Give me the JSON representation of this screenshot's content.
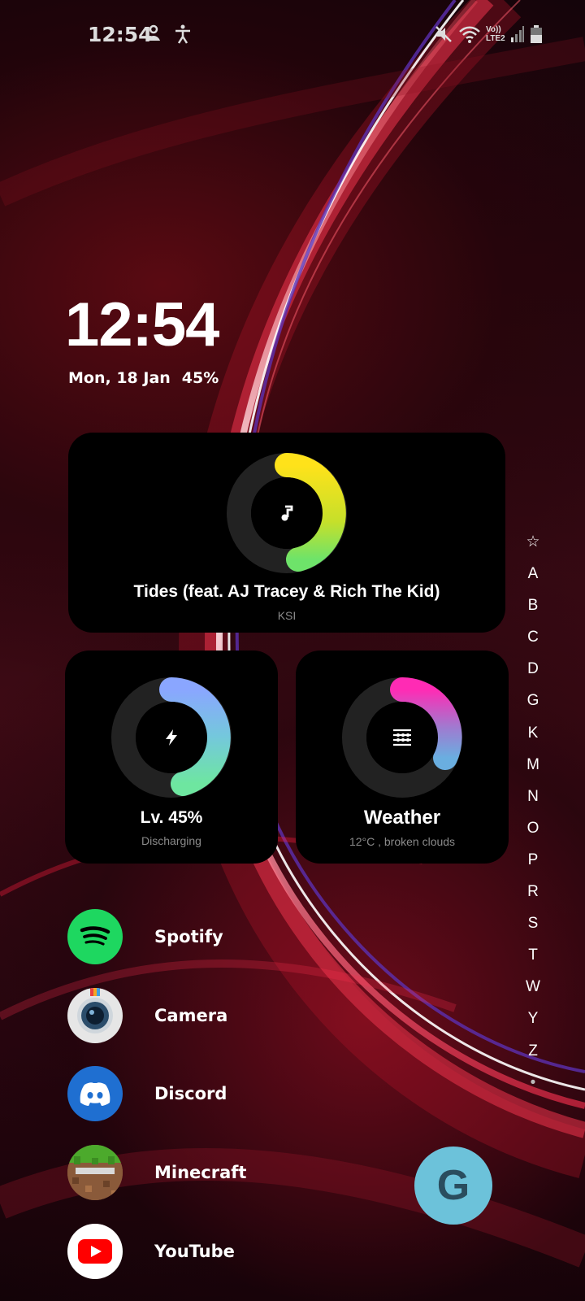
{
  "status_bar": {
    "time": "12:54",
    "lte_label_top": "Vo))",
    "lte_label_bottom": "LTE2",
    "icons": [
      "bixby-icon",
      "accessibility-icon",
      "mute-icon",
      "wifi-icon",
      "signal-icon",
      "battery-icon"
    ]
  },
  "clock": {
    "time": "12:54",
    "date": "Mon, 18 Jan",
    "battery": "45%"
  },
  "music_widget": {
    "title": "Tides (feat. AJ Tracey & Rich The Kid)",
    "artist": "KSI",
    "icon": "music-note-icon"
  },
  "battery_widget": {
    "level": "Lv. 45%",
    "status": "Discharging",
    "icon": "bolt-icon"
  },
  "weather_widget": {
    "title": "Weather",
    "description": "12°C , broken clouds",
    "icon": "weather-lines-icon"
  },
  "alphabet_index": [
    "☆",
    "A",
    "B",
    "C",
    "D",
    "G",
    "K",
    "M",
    "N",
    "O",
    "P",
    "R",
    "S",
    "T",
    "W",
    "Y",
    "Z",
    "•"
  ],
  "apps": [
    {
      "name": "Spotify",
      "icon": "spotify-icon"
    },
    {
      "name": "Camera",
      "icon": "camera-icon"
    },
    {
      "name": "Discord",
      "icon": "discord-icon"
    },
    {
      "name": "Minecraft",
      "icon": "minecraft-icon"
    },
    {
      "name": "YouTube",
      "icon": "youtube-icon"
    }
  ],
  "google_button": {
    "label": "G"
  },
  "colors": {
    "spotify": "#1ed760",
    "discord": "#1f6fd1",
    "youtube": "#ff0000",
    "google_fab": "#6cc2da"
  }
}
